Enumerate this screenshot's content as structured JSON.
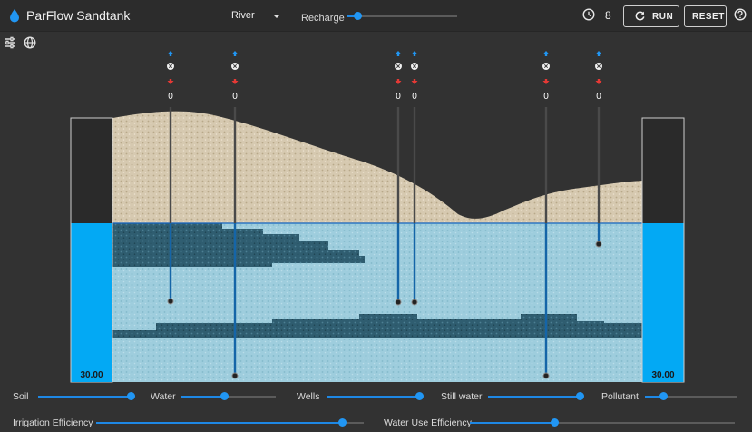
{
  "header": {
    "title": "ParFlow Sandtank",
    "select_value": "River",
    "recharge_label": "Recharge",
    "recharge_value": 0.1,
    "time_value": "8",
    "run_label": "RUN",
    "reset_label": "RESET"
  },
  "tools": [
    "tune-icon",
    "globe-icon"
  ],
  "wells": [
    {
      "name": "well-1",
      "value": "0"
    },
    {
      "name": "well-2",
      "value": "0"
    },
    {
      "name": "well-3",
      "value": "0"
    },
    {
      "name": "well-4",
      "value": "0"
    },
    {
      "name": "well-5",
      "value": "0"
    },
    {
      "name": "well-6",
      "value": "0"
    }
  ],
  "left_level": "30.00",
  "right_level": "30.00",
  "sliders": {
    "soil": {
      "label": "Soil",
      "value": 1.0
    },
    "water": {
      "label": "Water",
      "value": 0.45
    },
    "wells": {
      "label": "Wells",
      "value": 1.0
    },
    "still_water": {
      "label": "Still water",
      "value": 1.0
    },
    "pollutant": {
      "label": "Pollutant",
      "value": 0.2
    },
    "irrigation": {
      "label": "Irrigation Efficiency",
      "value": 0.92
    },
    "water_use": {
      "label": "Water Use Efficiency",
      "value": 0.32
    }
  },
  "colors": {
    "accent": "#2196f3",
    "water": "#03a9f4",
    "sand": "#d8cbb3",
    "deep": "#2e5b6e"
  }
}
